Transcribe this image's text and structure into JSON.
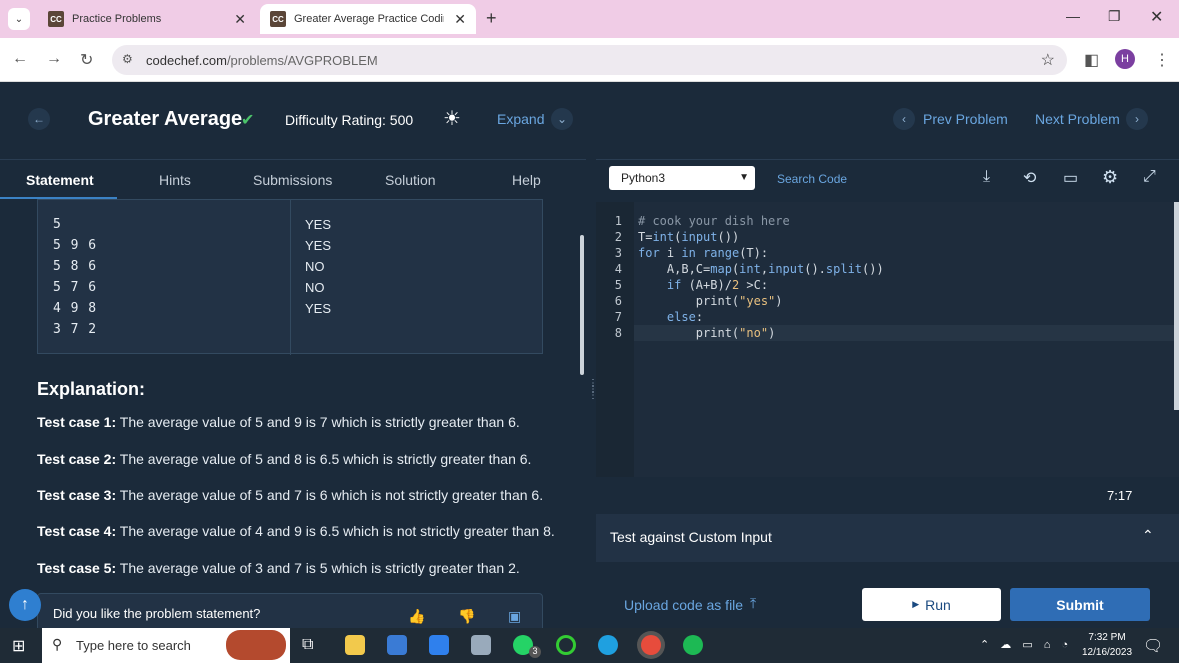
{
  "browser": {
    "tabs": [
      {
        "title": "Practice Problems",
        "favicon": "CC"
      },
      {
        "title": "Greater Average Practice Coding P",
        "favicon": "CC"
      }
    ],
    "url_host": "codechef.com",
    "url_path": "/problems/AVGPROBLEM",
    "profile_initial": "H"
  },
  "header": {
    "title": "Greater Average",
    "difficulty": "Difficulty Rating: 500",
    "expand": "Expand",
    "prev": "Prev Problem",
    "next": "Next Problem"
  },
  "problem_tabs": [
    "Statement",
    "Hints",
    "Submissions",
    "Solution",
    "Help"
  ],
  "sample": {
    "inputs": [
      "5",
      "5 9 6",
      "5 8 6",
      "5 7 6",
      "4 9 8",
      "3 7 2"
    ],
    "outputs": [
      "YES",
      "YES",
      "NO",
      "NO",
      "YES"
    ]
  },
  "explanation": {
    "heading": "Explanation:",
    "cases": [
      {
        "label": "Test case 1:",
        "text": " The average value of 5 and 9 is 7 which is strictly greater than 6."
      },
      {
        "label": "Test case 2:",
        "text": " The average value of 5 and 8 is 6.5 which is strictly greater than 6."
      },
      {
        "label": "Test case 3:",
        "text": " The average value of 5 and 7 is 6 which is not strictly greater than 6."
      },
      {
        "label": "Test case 4:",
        "text": " The average value of 4 and 9 is 6.5 which is not strictly greater than 8."
      },
      {
        "label": "Test case 5:",
        "text": " The average value of 3 and 7 is 5 which is strictly greater than 2."
      }
    ]
  },
  "feedback": "Did you like the problem statement?",
  "editor": {
    "language": "Python3",
    "search": "Search Code",
    "line_numbers": [
      "1",
      "2",
      "3",
      "4",
      "5",
      "6",
      "7",
      "8"
    ],
    "timer": "7:17"
  },
  "custom_input": "Test against Custom Input",
  "upload": "Upload code as file",
  "run": "Run",
  "submit": "Submit",
  "taskbar": {
    "search_placeholder": "Type here to search",
    "time": "7:32 PM",
    "date": "12/16/2023",
    "whatsapp_badge": "3"
  }
}
